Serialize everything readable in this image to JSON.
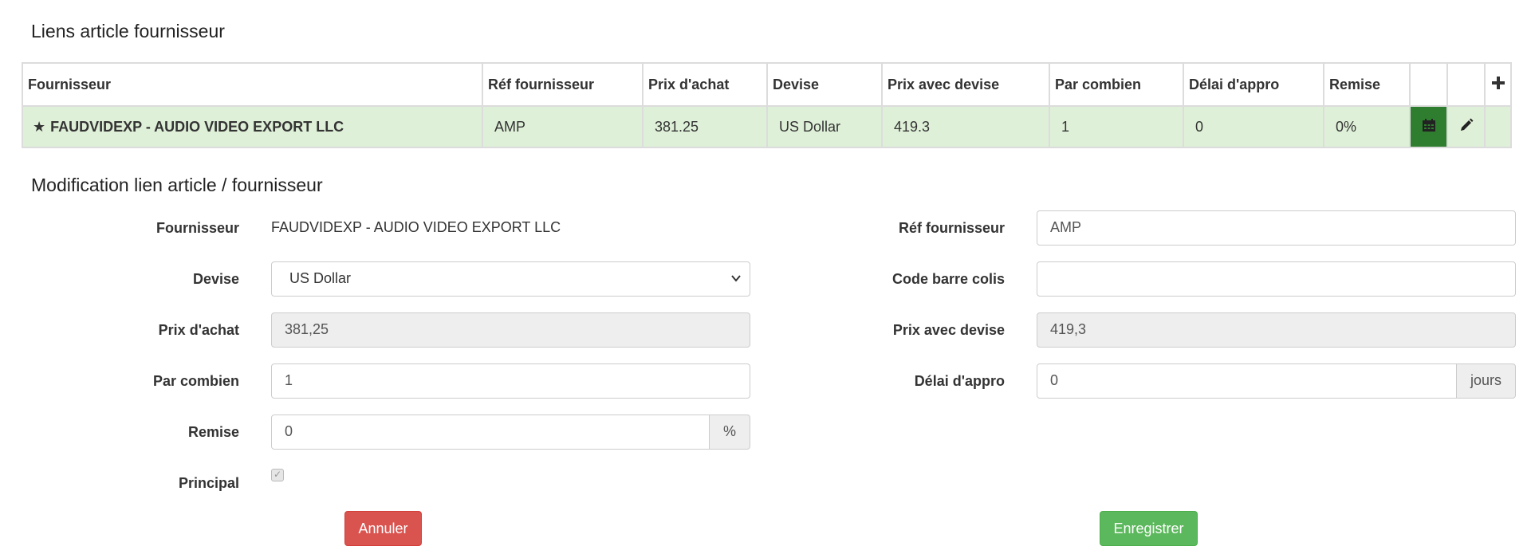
{
  "links_title": "Liens article fournisseur",
  "modification_title": "Modification lien article / fournisseur",
  "table": {
    "headers": [
      "Fournisseur",
      "Réf fournisseur",
      "Prix d'achat",
      "Devise",
      "Prix avec devise",
      "Par combien",
      "Délai d'appro",
      "Remise"
    ],
    "add_icon": "plus-icon",
    "rows": [
      {
        "fournisseur": "FAUDVIDEXP - AUDIO VIDEO EXPORT LLC",
        "ref": "AMP",
        "prix_achat": "381.25",
        "devise": "US Dollar",
        "prix_devise": "419.3",
        "par_combien": "1",
        "delai": "0",
        "remise": "0%",
        "principal_icon": "star-icon",
        "calendar_icon": "calendar-icon",
        "edit_icon": "pencil-icon"
      }
    ]
  },
  "form": {
    "fournisseur_label": "Fournisseur",
    "fournisseur_value": "FAUDVIDEXP - AUDIO VIDEO EXPORT LLC",
    "devise_label": "Devise",
    "devise_value": "US Dollar",
    "prix_achat_label": "Prix d'achat",
    "prix_achat_value": "381,25",
    "par_combien_label": "Par combien",
    "par_combien_value": "1",
    "remise_label": "Remise",
    "remise_value": "0",
    "remise_addon": "%",
    "principal_label": "Principal",
    "principal_checked": true,
    "ref_label": "Réf fournisseur",
    "ref_value": "AMP",
    "code_barre_label": "Code barre colis",
    "code_barre_value": "",
    "prix_devise_label": "Prix avec devise",
    "prix_devise_value": "419,3",
    "delai_label": "Délai d'appro",
    "delai_value": "0",
    "delai_addon": "jours"
  },
  "buttons": {
    "cancel_label": "Annuler",
    "save_label": "Enregistrer"
  },
  "colors": {
    "row_bg": "#dff0d8",
    "calendar_bg": "#2f7d2f",
    "cancel": "#d9534f",
    "save": "#5cb85c"
  }
}
